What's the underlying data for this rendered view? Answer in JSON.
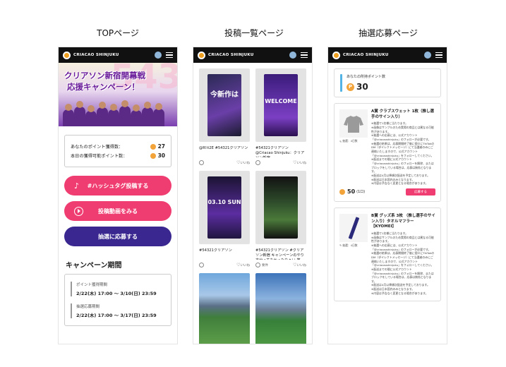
{
  "columns": {
    "top": "TOPページ",
    "posts": "投稿一覧ページ",
    "apply": "抽選応募ページ"
  },
  "header": {
    "brand": "CRIACAO SHINJUKU"
  },
  "top": {
    "hero_line1": "クリアソン新宿開幕戦",
    "hero_line2": "応援キャンペーン！",
    "hero_bg": "543",
    "points": [
      {
        "label": "あなたのポイント獲得数：",
        "value": "27"
      },
      {
        "label": "本日の獲得可能ポイント数：",
        "value": "30"
      }
    ],
    "btn_hashtag": "#ハッシュタグ投稿する",
    "btn_view": "投稿動画をみる",
    "btn_apply": "抽選に応募する",
    "campaign_title": "キャンペーン期間",
    "periods": [
      {
        "label": "ポイント獲得期間",
        "value": "2/22(木) 17:00 ～ 3/10(日) 23:59"
      },
      {
        "label": "抽選応募期間",
        "value": "2/22(木) 17:00 ～ 3/17(日) 23:59"
      }
    ]
  },
  "posts": [
    {
      "thumb_text": "今新作は",
      "caption": "@R!it2E #54321クリアソン",
      "likes": "いいね",
      "user": ""
    },
    {
      "thumb_text": "WELCOME",
      "caption": "#54321クリアソン @Criacao Shinjuku：クリアソン新宿",
      "likes": "いいね",
      "user": ""
    },
    {
      "thumb_text": "03.10 SUN",
      "caption": "#54321クリアソン",
      "likes": "いいね",
      "user": ""
    },
    {
      "thumb_text": "",
      "caption": "#54321クリアソン #クリアソン新宿 キャンペーンのやり方分ってなかったなぁい 笑",
      "likes": "いいね",
      "user": "要件"
    },
    {
      "thumb_text": "",
      "caption": "",
      "likes": "",
      "user": ""
    },
    {
      "thumb_text": "",
      "caption": "",
      "likes": "",
      "user": ""
    }
  ],
  "apply": {
    "own_label": "あなたの所持ポイント数",
    "own_value": "30",
    "prizes": [
      {
        "name": "A賞 クラブスウェット 1枚（推し選手のサイン入り）",
        "sub": "抽選：4日数",
        "note": "※抽選で1名様に当たります。\n※画像はサンプルのため実際の商品とは異なる可能性があります。\n※抽選への応募には、公式アカウント「@criacaoshinjuku」のフォローが必要です。\n※抽選の結果は、応募期間終了後に個々にTikTokのDM（ダイレクトメッセージ）にて当選者のみにご連絡いたしますので、公式アカウント「@criacaoshinjuku」をフォローしてください。\n※配送までの間に公式アカウント「@criacaoshinjuku」のフォローを解除、またはブロックをしている場合は、応募は無効となります。\n※配送は4月以降順次配送を予定しております。\n※配送は日本国内のみとなります。\n※内容は予告なく変更となる場合があります。",
        "cost": "50",
        "unit": "(1口)",
        "button": "応募する"
      },
      {
        "name": "B賞 グッズ系 3枚 （推し選手のサイン入り）タオルマフラー【KYOMEI】",
        "sub": "抽選：4日数",
        "note": "※抽選で1名様に当たります。\n※画像はサンプルのため実際の商品とは異なる可能性があります。\n※抽選への応募には、公式アカウント「@criacaoshinjuku」のフォローが必要です。\n※抽選の結果は、応募期間終了後に個々にTikTokのDM（ダイレクトメッセージ）にて当選者のみにご連絡いたしますので、公式アカウント「@criacaoshinjuku」をフォローしてください。\n※配送までの間に公式アカウント「@criacaoshinjuku」のフォローを解除、またはブロックをしている場合は、応募は無効となります。\n※配送は4月以降順次配送を予定しております。\n※配送は日本国内のみとなります。\n※内容は予告なく変更となる場合があります。",
        "cost": "",
        "unit": "",
        "button": ""
      }
    ]
  },
  "colors": {
    "pink": "#f03d71",
    "purple": "#3a2890",
    "coin": "#f2a33a",
    "header": "#111111"
  }
}
